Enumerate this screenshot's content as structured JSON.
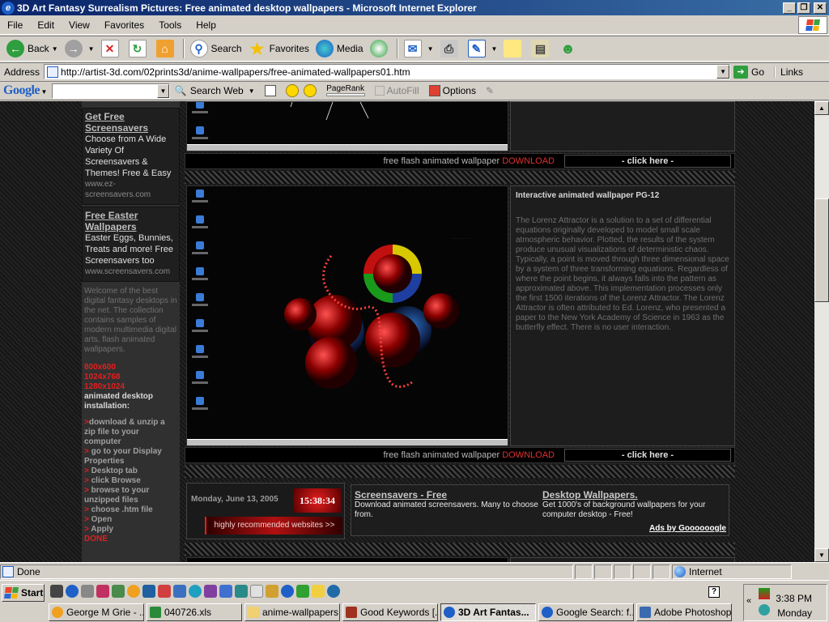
{
  "window": {
    "title": "3D Art Fantasy Surrealism Pictures: Free animated desktop wallpapers - Microsoft Internet Explorer"
  },
  "menu": [
    "File",
    "Edit",
    "View",
    "Favorites",
    "Tools",
    "Help"
  ],
  "toolbar": {
    "back": "Back",
    "search": "Search",
    "favorites": "Favorites",
    "media": "Media"
  },
  "address": {
    "label": "Address",
    "url": "http://artist-3d.com/02prints3d/anime-wallpapers/free-animated-wallpapers01.htm",
    "go": "Go",
    "links": "Links"
  },
  "googlebar": {
    "logo": "Google",
    "search_web": "Search Web",
    "pagerank": "PageRank",
    "autofill": "AutoFill",
    "options": "Options"
  },
  "left": {
    "promo1": {
      "heading": "Get Free Screensavers",
      "text": "Choose from A Wide Variety Of Screensavers & Themes! Free & Easy",
      "url": "www.ez-screensavers.com"
    },
    "promo2": {
      "heading": "Free Easter Wallpapers",
      "text": "Easter Eggs, Bunnies, Treats and more! Free Screensavers too",
      "url": "www.screensavers.com"
    },
    "welcome": "Welcome of the best digital fantasy desktops in the net. The collection contains samples of modern multimedia digital arts, flash animated wallpapers.",
    "res1": "800x600",
    "res2": "1024x768",
    "res3": "1280x1024",
    "install_heading": "animated desktop installation:",
    "steps": [
      "download & unzip a zip file to your computer",
      "go to your Display Properties",
      "Desktop tab",
      "click Browse",
      "browse to your unzipped files",
      "choose .htm file",
      "Open",
      "Apply"
    ],
    "done": "DONE"
  },
  "main": {
    "download_bar": {
      "message": "free flash animated wallpaper",
      "download": "DOWNLOAD",
      "click": "- click here -"
    },
    "item": {
      "title": "Interactive animated wallpaper PG-12",
      "description": "The Lorenz Attractor is a solution to a set of differential equations originally developed to model small scale atmospheric behavior. Plotted, the results of the system produce unusual visualizations of deterministic chaos. Typically, a point is moved through three dimensional space by a system of three transforming equations. Regardless of where the point begins, it always falls into the pattern as approximated above. This implementation processes only the first 1500 iterations of the Lorenz Attractor. The Lorenz Attractor is often attributed to Ed. Lorenz, who presented a paper to the New York Academy of Science in 1963 as the butterfly effect. There is no user interaction."
    },
    "clock": {
      "date": "Monday, June 13, 2005",
      "time": "15:38:34",
      "recommended": "highly recommended websites >>"
    },
    "ads": {
      "ad1_title": "Screensavers - Free",
      "ad1_text": "Download animated screensavers. Many to choose from.",
      "ad2_title": "Desktop Wallpapers.",
      "ad2_text": "Get 1000's of background wallpapers for your computer desktop - Free!",
      "ads_by": "Ads by Goooooogle"
    }
  },
  "status": {
    "text": "Done",
    "zone": "Internet"
  },
  "taskbar": {
    "start": "Start",
    "tasks": [
      "George M Grie - ...",
      "040726.xls",
      "anime-wallpapers",
      "Good Keywords [...",
      "3D Art Fantas...",
      "Google Search: f...",
      "Adobe Photoshop"
    ],
    "time": "3:38 PM",
    "day": "Monday"
  },
  "colors": {
    "title_start": "#0a246a",
    "title_end": "#3a6ea5",
    "accent_red": "#e02020"
  }
}
